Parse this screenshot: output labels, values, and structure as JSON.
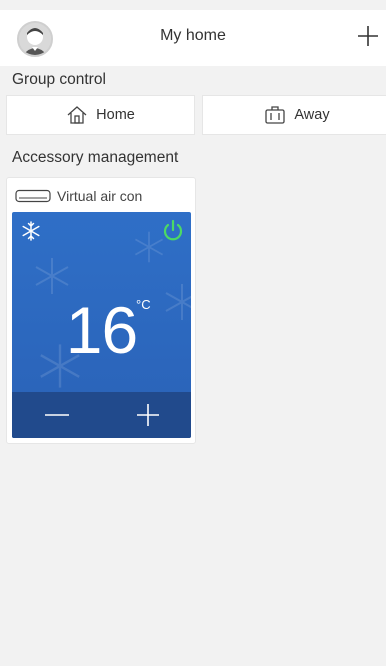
{
  "header": {
    "title": "My home",
    "add_label": "+"
  },
  "group_control": {
    "title": "Group control",
    "buttons": [
      {
        "label": "Home",
        "icon": "home-icon"
      },
      {
        "label": "Away",
        "icon": "suitcase-icon"
      }
    ]
  },
  "accessory": {
    "title": "Accessory management",
    "card": {
      "name": "Virtual air con",
      "device_icon": "air-conditioner-icon",
      "mode_icon": "snowflake-icon",
      "power_icon": "power-icon",
      "temperature": "16",
      "unit": "°C",
      "decrease_label": "—",
      "increase_label": "+"
    }
  },
  "colors": {
    "panel": "#2f6fc7",
    "panel_bottom": "#214a8c",
    "power": "#4cd964"
  }
}
